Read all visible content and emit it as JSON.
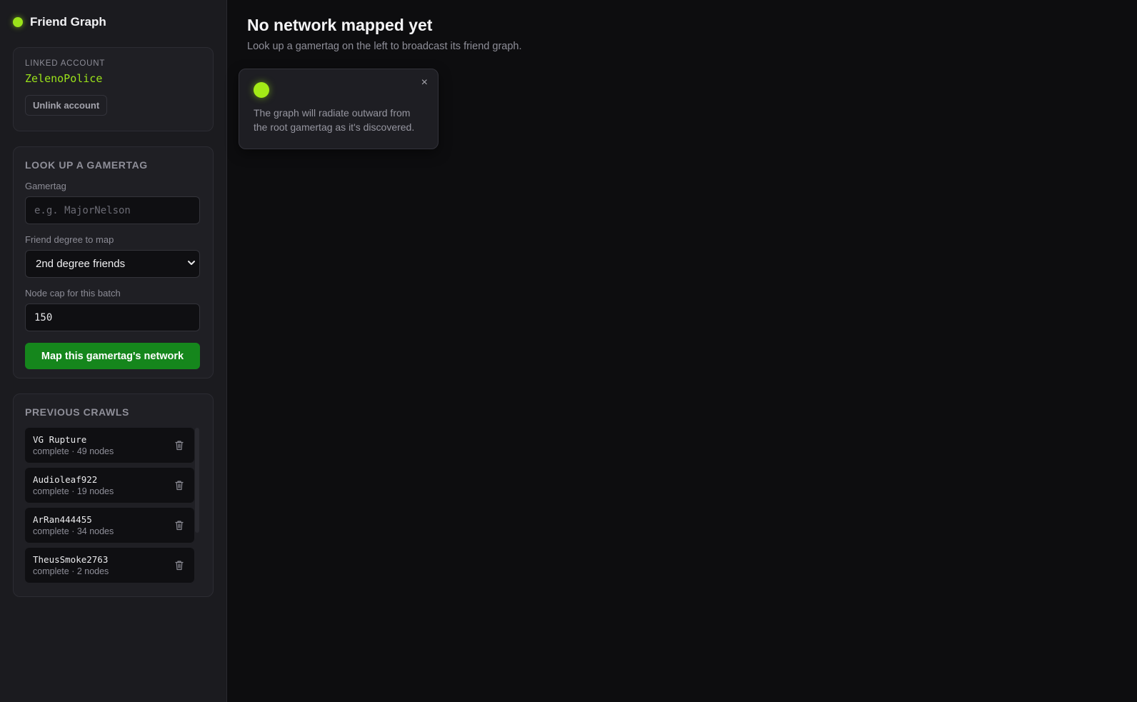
{
  "brand": {
    "title": "Friend Graph",
    "accent": "#9be31a"
  },
  "account": {
    "label": "LINKED ACCOUNT",
    "name": "ZelenoPolice",
    "unlink_label": "Unlink account"
  },
  "lookup": {
    "title": "LOOK UP A GAMERTAG",
    "gamertag_label": "Gamertag",
    "gamertag_placeholder": "e.g. MajorNelson",
    "gamertag_value": "",
    "degree_label": "Friend degree to map",
    "degree_selected": "2nd degree friends",
    "cap_label": "Node cap for this batch",
    "cap_value": "150",
    "submit_label": "Map this gamertag's network",
    "submit_color": "#15861c"
  },
  "crawls": {
    "title": "PREVIOUS CRAWLS",
    "items": [
      {
        "name": "VG Rupture",
        "meta": "complete · 49 nodes"
      },
      {
        "name": "Audioleaf922",
        "meta": "complete · 19 nodes"
      },
      {
        "name": "ArRan444455",
        "meta": "complete · 34 nodes"
      },
      {
        "name": "TheusSmoke2763",
        "meta": "complete · 2 nodes"
      }
    ]
  },
  "main": {
    "title": "No network mapped yet",
    "subtitle": "Look up a gamertag on the left to broadcast its friend graph."
  },
  "toast": {
    "text": "The graph will radiate outward from the root gamertag as it's discovered.",
    "close_glyph": "×"
  }
}
